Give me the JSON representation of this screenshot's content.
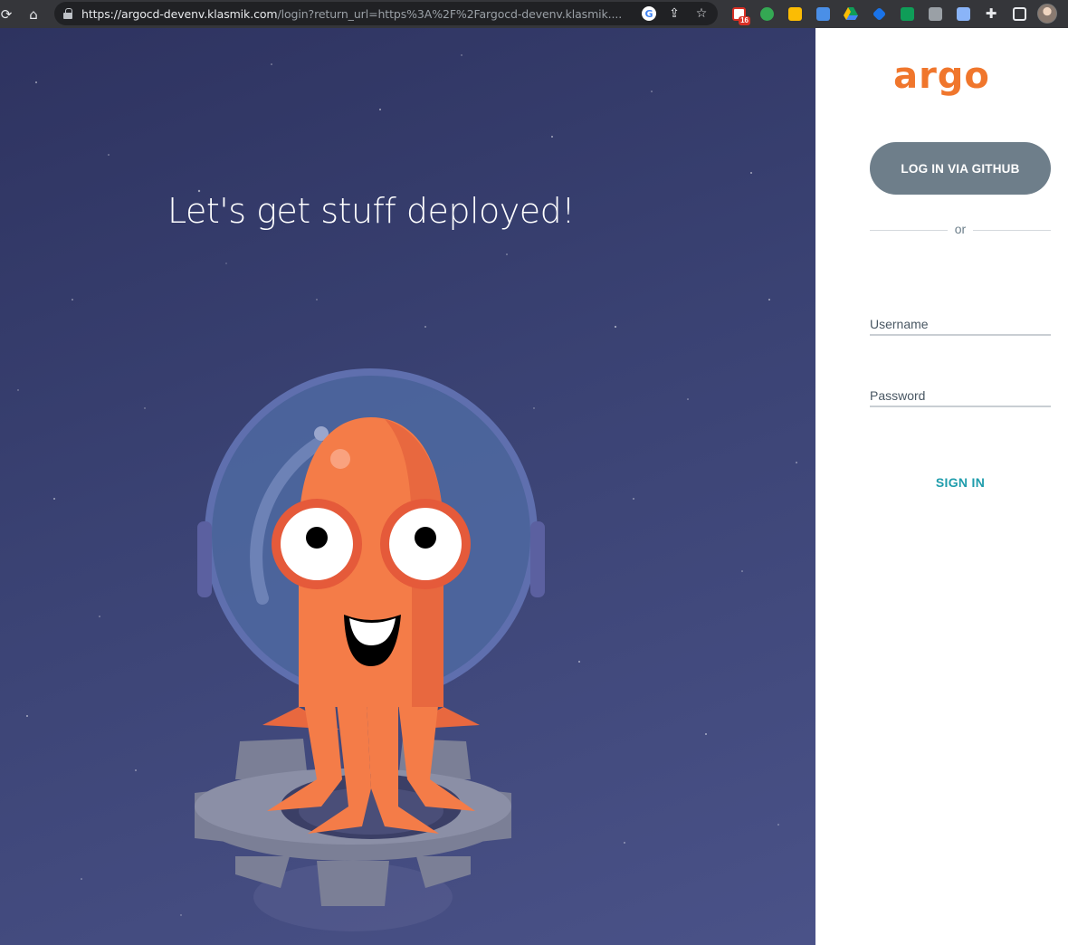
{
  "browser": {
    "url_host": "https://argocd-devenv.klasmik.com",
    "url_rest": "/login?return_url=https%3A%2F%2Fargocd-devenv.klasmik....",
    "gmail_badge": "16"
  },
  "hero": {
    "headline": "Let's get stuff deployed!"
  },
  "login": {
    "logo_text": "argo",
    "github_button": "LOG IN VIA GITHUB",
    "divider_text": "or",
    "username_placeholder": "Username",
    "password_placeholder": "Password",
    "signin_button": "SIGN IN"
  },
  "colors": {
    "brand_orange": "#f0762c",
    "github_button_bg": "#6e7e8a",
    "signin_teal": "#1f9dac",
    "hero_bg": "#3a4273"
  },
  "icons": [
    "reload-icon",
    "home-icon",
    "lock-icon",
    "google-icon",
    "share-icon",
    "star-icon",
    "extensions-icon",
    "sidebar-icon"
  ]
}
